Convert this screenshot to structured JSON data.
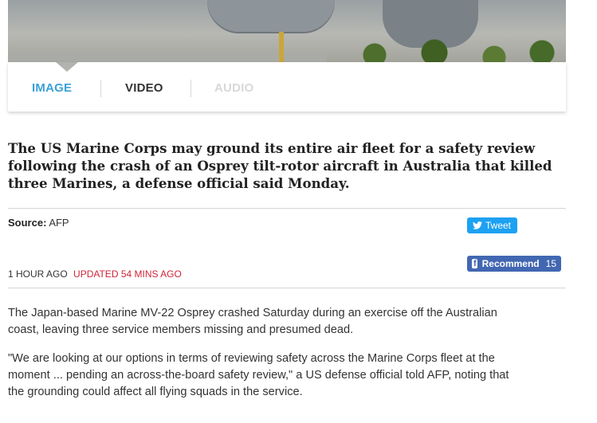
{
  "media_tabs": {
    "image": "IMAGE",
    "video": "VIDEO",
    "audio": "AUDIO"
  },
  "article": {
    "headline_lines": [
      "The US Marine Corps may ground its entire air fleet for a safety review",
      "following the crash of an Osprey tilt-rotor aircraft in Australia that killed",
      "three Marines, a defense official said Monday."
    ],
    "source_label": "Source:",
    "source_value": "AFP",
    "published": "1 HOUR AGO",
    "updated": "UPDATED 54 MINS AGO",
    "paragraphs": [
      [
        "The Japan-based Marine MV-22 Osprey crashed Saturday during an exercise off the Australian",
        "coast, leaving three service members missing and presumed dead."
      ],
      [
        "\"We are looking at our options in terms of reviewing safety across the Marine Corps fleet at the",
        "moment ... pending an across-the-board safety review,\" a US defense official told AFP, noting that",
        "the grounding could affect all flying squads in the service."
      ]
    ]
  },
  "share": {
    "tweet_label": "Tweet",
    "recommend_label": "Recommend",
    "recommend_count": "15"
  },
  "icons": {
    "twitter": "twitter-bird-icon",
    "facebook": "facebook-f-icon"
  },
  "colors": {
    "tab_active": "#3aa1d8",
    "tweet_bg": "#1da1f2",
    "facebook_bg": "#4267b2",
    "updated_text": "#d0253a"
  }
}
